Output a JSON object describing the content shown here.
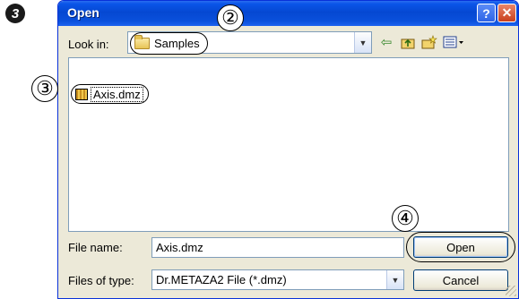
{
  "step_marker": "3",
  "dialog": {
    "title": "Open",
    "help_glyph": "?",
    "close_glyph": "✕"
  },
  "lookin": {
    "label": "Look in:",
    "value": "Samples"
  },
  "callouts": [
    "②",
    "③",
    "④"
  ],
  "files": [
    {
      "name": "Axis.dmz"
    }
  ],
  "filename": {
    "label": "File name:",
    "value": "Axis.dmz"
  },
  "filetype": {
    "label": "Files of type:",
    "value": "Dr.METAZA2 File (*.dmz)"
  },
  "buttons": {
    "open": "Open",
    "cancel": "Cancel"
  },
  "icons": {
    "toolbar": [
      "back-arrow-icon",
      "up-one-level-icon",
      "new-folder-icon",
      "views-menu-icon"
    ]
  },
  "colors": {
    "titlebar": "#0548d2",
    "dialog_bg": "#ece9d8",
    "field_border": "#7f9db9"
  }
}
